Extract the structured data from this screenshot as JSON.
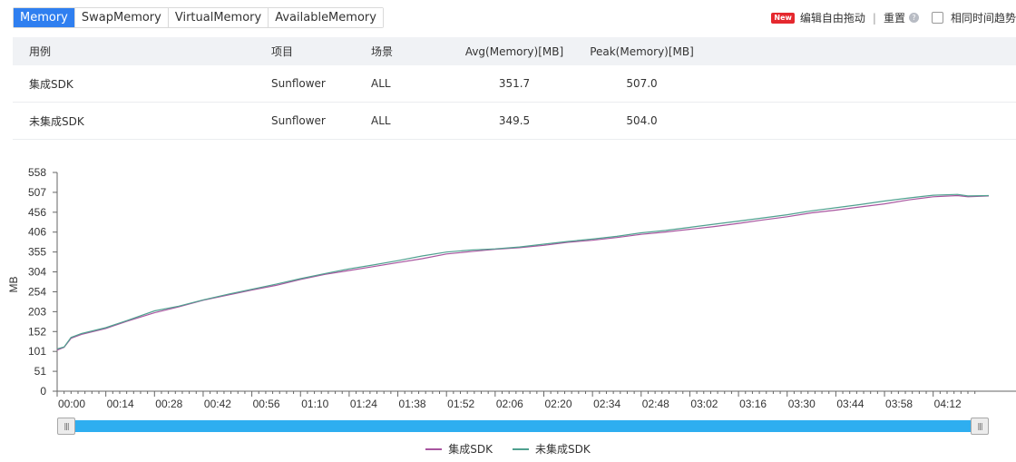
{
  "tabs": [
    {
      "label": "Memory",
      "active": true
    },
    {
      "label": "SwapMemory",
      "active": false
    },
    {
      "label": "VirtualMemory",
      "active": false
    },
    {
      "label": "AvailableMemory",
      "active": false
    }
  ],
  "toolbar": {
    "new_badge": "New",
    "edit_label": "编辑自由拖动",
    "separator": "|",
    "reset_label": "重置",
    "help_glyph": "?",
    "same_time_label": "相同时间趋势"
  },
  "table": {
    "headers": [
      "用例",
      "项目",
      "场景",
      "Avg(Memory)[MB]",
      "Peak(Memory)[MB]"
    ],
    "rows": [
      [
        "集成SDK",
        "Sunflower",
        "ALL",
        "351.7",
        "507.0"
      ],
      [
        "未集成SDK",
        "Sunflower",
        "ALL",
        "349.5",
        "504.0"
      ]
    ]
  },
  "chart_data": {
    "type": "line",
    "ylabel": "MB",
    "ylim": [
      0,
      558
    ],
    "y_ticks": [
      "558",
      "507",
      "456",
      "406",
      "355",
      "304",
      "254",
      "203",
      "152",
      "101",
      "51",
      "0"
    ],
    "x_ticks": [
      "00:00",
      "00:14",
      "00:28",
      "00:42",
      "00:56",
      "01:10",
      "01:24",
      "01:38",
      "01:52",
      "02:06",
      "02:20",
      "02:34",
      "02:48",
      "03:02",
      "03:16",
      "03:30",
      "03:44",
      "03:58",
      "04:12"
    ],
    "x_seconds_range": [
      0,
      268
    ],
    "series": [
      {
        "name": "集成SDK",
        "color": "#a8559f",
        "points": [
          [
            0,
            105
          ],
          [
            2,
            112
          ],
          [
            4,
            135
          ],
          [
            7,
            145
          ],
          [
            14,
            160
          ],
          [
            20,
            178
          ],
          [
            28,
            200
          ],
          [
            35,
            215
          ],
          [
            42,
            232
          ],
          [
            49,
            245
          ],
          [
            56,
            258
          ],
          [
            63,
            270
          ],
          [
            70,
            285
          ],
          [
            77,
            298
          ],
          [
            84,
            308
          ],
          [
            91,
            318
          ],
          [
            98,
            328
          ],
          [
            105,
            338
          ],
          [
            112,
            350
          ],
          [
            119,
            356
          ],
          [
            126,
            362
          ],
          [
            133,
            366
          ],
          [
            140,
            372
          ],
          [
            147,
            380
          ],
          [
            154,
            385
          ],
          [
            161,
            392
          ],
          [
            168,
            400
          ],
          [
            175,
            406
          ],
          [
            182,
            413
          ],
          [
            189,
            420
          ],
          [
            196,
            428
          ],
          [
            203,
            437
          ],
          [
            210,
            445
          ],
          [
            217,
            455
          ],
          [
            224,
            462
          ],
          [
            231,
            470
          ],
          [
            238,
            478
          ],
          [
            245,
            488
          ],
          [
            252,
            496
          ],
          [
            259,
            499
          ],
          [
            262,
            496
          ],
          [
            268,
            498
          ]
        ]
      },
      {
        "name": "未集成SDK",
        "color": "#4fa08f",
        "points": [
          [
            0,
            108
          ],
          [
            2,
            113
          ],
          [
            4,
            137
          ],
          [
            7,
            147
          ],
          [
            14,
            162
          ],
          [
            20,
            180
          ],
          [
            28,
            205
          ],
          [
            35,
            217
          ],
          [
            42,
            233
          ],
          [
            49,
            247
          ],
          [
            56,
            260
          ],
          [
            63,
            273
          ],
          [
            70,
            287
          ],
          [
            77,
            300
          ],
          [
            84,
            312
          ],
          [
            91,
            322
          ],
          [
            98,
            333
          ],
          [
            105,
            345
          ],
          [
            112,
            355
          ],
          [
            119,
            360
          ],
          [
            126,
            363
          ],
          [
            133,
            368
          ],
          [
            140,
            375
          ],
          [
            147,
            382
          ],
          [
            154,
            388
          ],
          [
            161,
            395
          ],
          [
            168,
            404
          ],
          [
            175,
            410
          ],
          [
            182,
            418
          ],
          [
            189,
            426
          ],
          [
            196,
            434
          ],
          [
            203,
            442
          ],
          [
            210,
            450
          ],
          [
            217,
            460
          ],
          [
            224,
            468
          ],
          [
            231,
            476
          ],
          [
            238,
            485
          ],
          [
            245,
            493
          ],
          [
            252,
            500
          ],
          [
            259,
            502
          ],
          [
            262,
            498
          ],
          [
            268,
            499
          ]
        ]
      }
    ]
  }
}
